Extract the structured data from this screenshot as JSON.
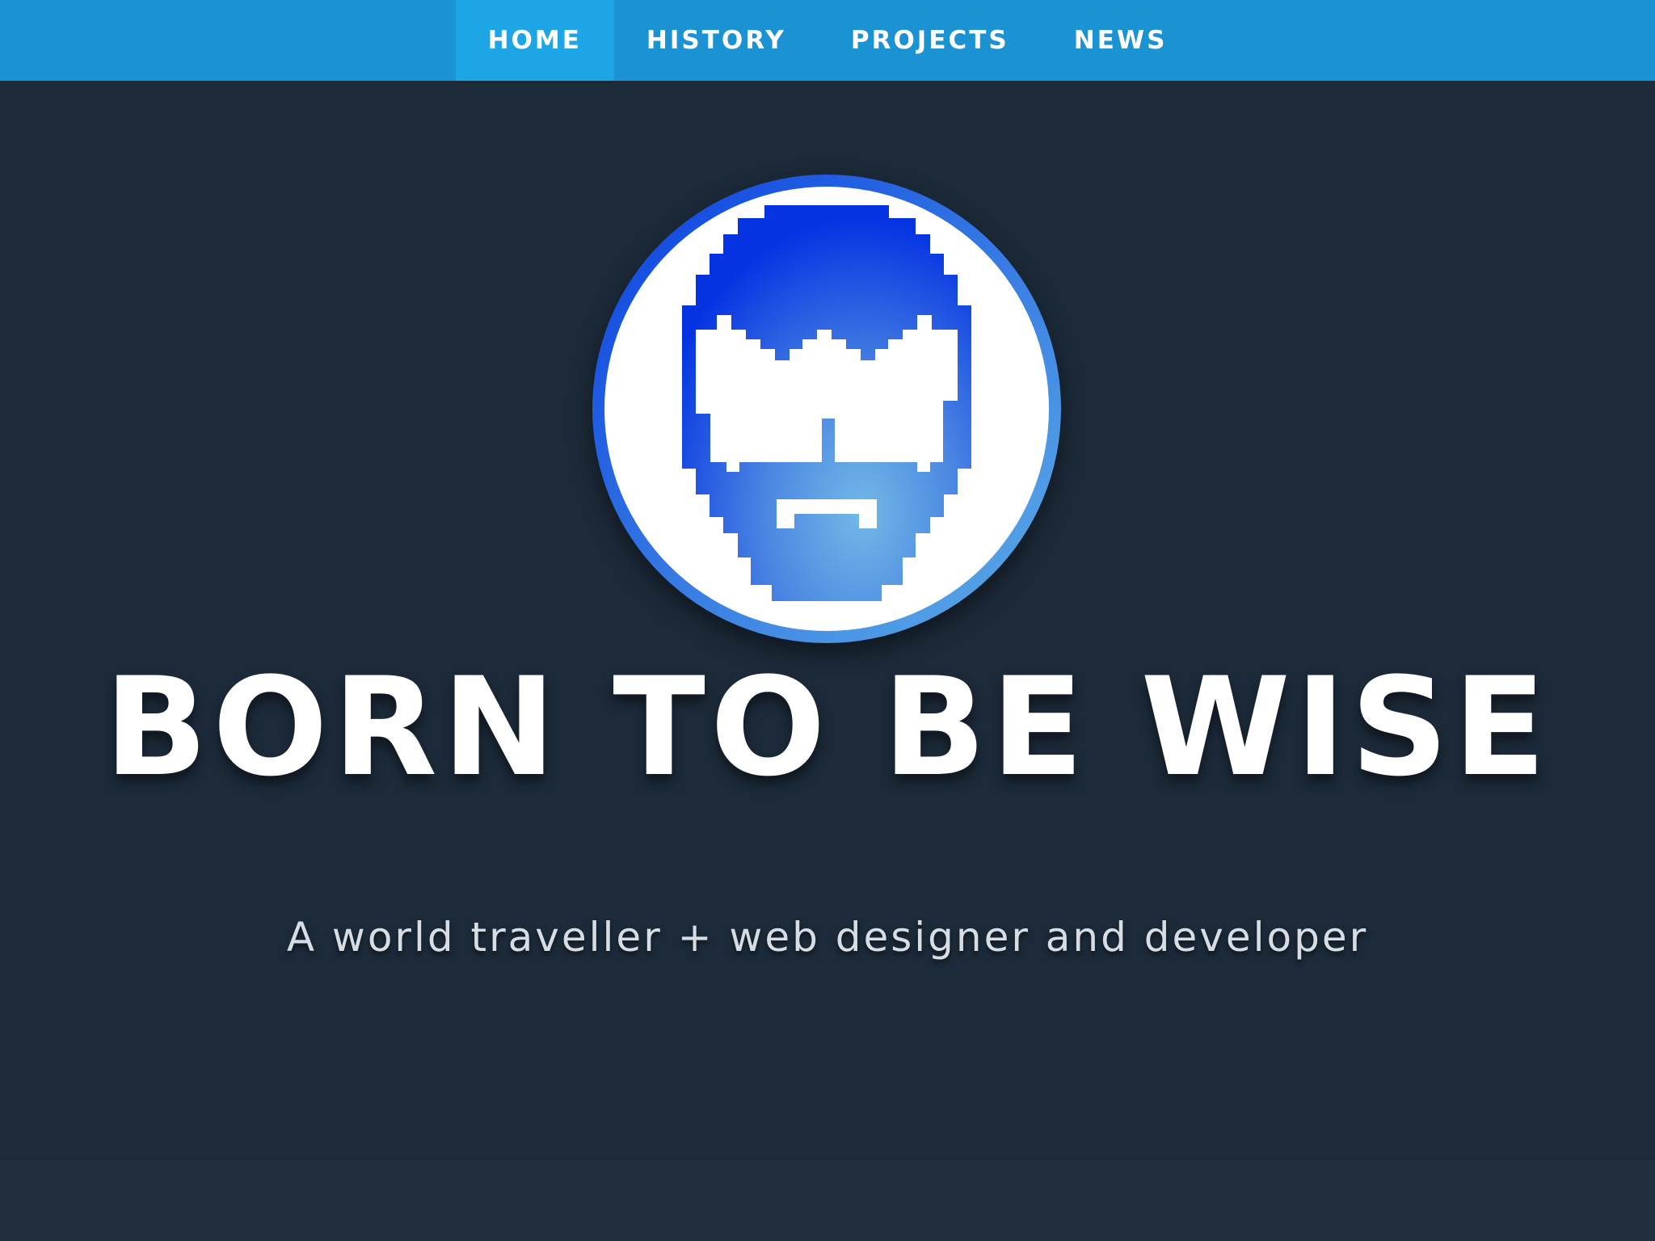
{
  "nav": {
    "items": [
      {
        "label": "HOME",
        "active": true
      },
      {
        "label": "HISTORY",
        "active": false
      },
      {
        "label": "PROJECTS",
        "active": false
      },
      {
        "label": "NEWS",
        "active": false
      }
    ]
  },
  "hero": {
    "logo_icon": "bearded-face-with-sunglasses-icon",
    "title": "BORN TO BE WISE",
    "subtitle": "A world traveller + web designer and developer"
  },
  "colors": {
    "nav_background": "#1b92d1",
    "nav_active": "#1ea5e6",
    "page_background": "#1c2a39",
    "footer_band": "#212e3e",
    "logo_blue_dark": "#0433e0",
    "logo_blue_light": "#6db8e8"
  }
}
